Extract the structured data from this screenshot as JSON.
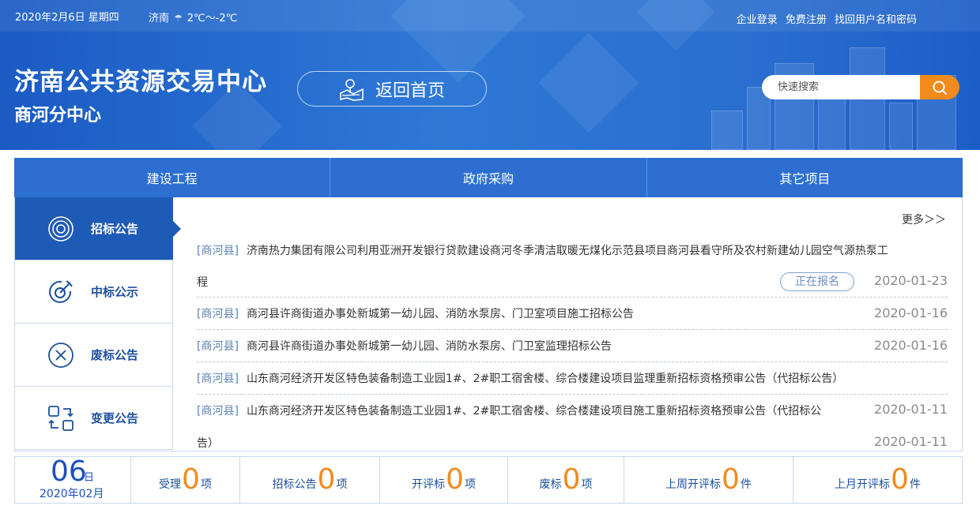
{
  "topbar": {
    "date": "2020年2月6日 星期四",
    "city": "济南",
    "temp": "2℃～-2℃",
    "links": [
      "企业登录",
      "免费注册",
      "找回用户名和密码"
    ]
  },
  "header": {
    "title": "济南公共资源交易中心",
    "subtitle": "商河分中心",
    "home_label": "返回首页",
    "search_placeholder": "快速搜索"
  },
  "nav": [
    "建设工程",
    "政府采购",
    "其它项目"
  ],
  "sidebar": [
    {
      "label": "招标公告",
      "icon": "target-icon",
      "active": true
    },
    {
      "label": "中标公示",
      "icon": "award-icon",
      "active": false
    },
    {
      "label": "废标公告",
      "icon": "cancel-circle-icon",
      "active": false
    },
    {
      "label": "变更公告",
      "icon": "change-icon",
      "active": false
    }
  ],
  "list": {
    "more": "更多＞＞",
    "items": [
      {
        "tag": "[商河县]",
        "title": "济南热力集团有限公司利用亚洲开发银行贷款建设商河冬季清洁取暖无煤化示范县项目商河县看守所及农村新建幼儿园空气源热泵工",
        "title2": "程",
        "badge": "正在报名",
        "date": "2020-01-23"
      },
      {
        "tag": "[商河县]",
        "title": "商河县许商街道办事处新城第一幼儿园、消防水泵房、门卫室项目施工招标公告",
        "date": "2020-01-16"
      },
      {
        "tag": "[商河县]",
        "title": "商河县许商街道办事处新城第一幼儿园、消防水泵房、门卫室监理招标公告",
        "date": "2020-01-16"
      },
      {
        "tag": "[商河县]",
        "title": "山东商河经济开发区特色装备制造工业园1#、2#职工宿舍楼、综合楼建设项目监理重新招标资格预审公告（代招标公告）",
        "date": ""
      },
      {
        "tag": "[商河县]",
        "title": "山东商河经济开发区特色装备制造工业园1#、2#职工宿舍楼、综合楼建设项目施工重新招标资格预审公告（代招标公",
        "title2": "告）",
        "date": "2020-01-11",
        "date2": "2020-01-11"
      }
    ]
  },
  "stats": {
    "day": "06",
    "day_unit": "日",
    "month": "2020年02月",
    "cells": [
      {
        "label": "受理",
        "value": "0",
        "unit": "项"
      },
      {
        "label": "招标公告",
        "value": "0",
        "unit": "项"
      },
      {
        "label": "开评标",
        "value": "0",
        "unit": "项"
      },
      {
        "label": "废标",
        "value": "0",
        "unit": "项"
      },
      {
        "label": "上周开评标",
        "value": "0",
        "unit": "件"
      },
      {
        "label": "上月开评标",
        "value": "0",
        "unit": "件"
      }
    ]
  },
  "colors": {
    "primary": "#2d6fd1",
    "accent": "#f28a1c",
    "sidebar_active": "#1e5bb6"
  }
}
